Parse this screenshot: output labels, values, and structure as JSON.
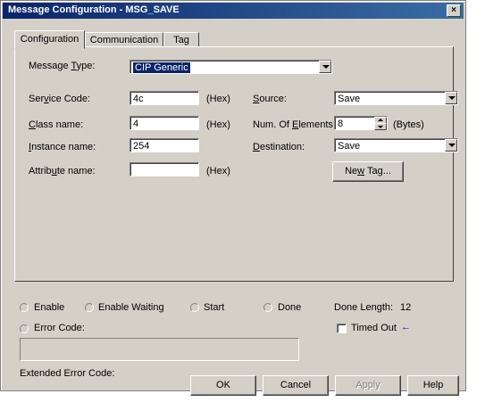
{
  "window": {
    "title": "Message Configuration - MSG_SAVE",
    "close_label": "×"
  },
  "tabs": [
    {
      "label": "Configuration",
      "active": true
    },
    {
      "label": "Communication",
      "active": false
    },
    {
      "label": "Tag",
      "active": false
    }
  ],
  "config": {
    "message_type": {
      "label_a": "Message ",
      "label_u": "T",
      "label_b": "ype:",
      "value": "CIP Generic"
    },
    "service_code": {
      "label_a": "Ser",
      "label_u": "v",
      "label_b": "ice Code:",
      "value": "4c",
      "unit": "(Hex)"
    },
    "class_name": {
      "label_a": "",
      "label_u": "C",
      "label_b": "lass name:",
      "value": "4",
      "unit": "(Hex)"
    },
    "instance_name": {
      "label_a": "",
      "label_u": "I",
      "label_b": "nstance name:",
      "value": "254"
    },
    "attribute_name": {
      "label_a": "Attrib",
      "label_u": "u",
      "label_b": "te name:",
      "value": "",
      "unit": "(Hex)"
    },
    "source": {
      "label_a": "",
      "label_u": "S",
      "label_b": "ource:",
      "value": "Save"
    },
    "num_elements": {
      "label_a": "Num. Of ",
      "label_u": "E",
      "label_b": "lements:",
      "value": "8",
      "unit": "(Bytes)"
    },
    "destination": {
      "label_a": "",
      "label_u": "D",
      "label_b": "estination:",
      "value": "Save"
    },
    "new_tag": {
      "label_a": "Ne",
      "label_u": "w",
      "label_b": " Tag..."
    }
  },
  "status": {
    "enable": "Enable",
    "enable_waiting": "Enable Waiting",
    "start": "Start",
    "done": "Done",
    "done_length_label": "Done Length:",
    "done_length_value": "12",
    "error_code": "Error Code:",
    "timed_out": "Timed Out",
    "timed_out_arrow": "←",
    "extended_error_code": "Extended Error Code:",
    "error_text": ""
  },
  "buttons": {
    "ok": "OK",
    "cancel": "Cancel",
    "apply": "Apply",
    "help": "Help"
  },
  "colors": {
    "title_bar": "#0a246a",
    "face": "#d4d0c8",
    "selection": "#0a246a",
    "arrow": "#0000ff"
  }
}
